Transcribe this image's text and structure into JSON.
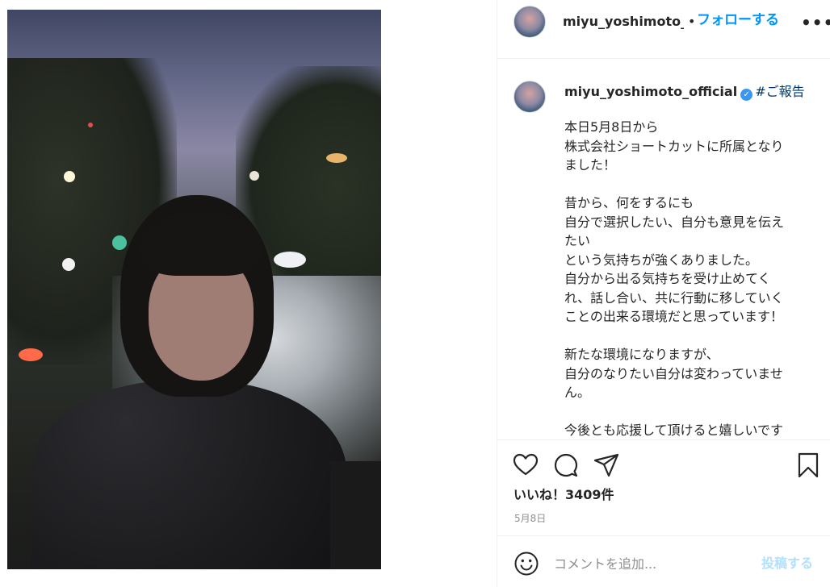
{
  "post": {
    "image_alt": ""
  },
  "header": {
    "username_truncated": "miyu_yoshimoto_o",
    "dot": "•",
    "follow_label": "フォローする",
    "more_label": "•••"
  },
  "caption": {
    "username": "miyu_yoshimoto_official",
    "verified_glyph": "✓",
    "hashtag": "#ご報告",
    "body": "本日5月8日から\n株式会社ショートカットに所属となり\nました！\n\n昔から、何をするにも\n自分で選択したい、自分も意見を伝え\nたい\nという気持ちが強くありました。\n自分から出る気持ちを受け止めてく\nれ、話し合い、共に行動に移していく\nことの出来る環境だと思っています！\n\n新たな環境になりますが、\n自分のなりたい自分は変わっていませ\nん。\n\n今後とも応援して頂けると嬉しいです\n☺"
  },
  "actions": {
    "icons": [
      "heart-icon",
      "comment-icon",
      "share-icon",
      "bookmark-icon"
    ]
  },
  "likes": "いいね！3409件",
  "date": "5月8日",
  "comment": {
    "placeholder": "コメントを追加...",
    "post_label": "投稿する"
  },
  "colors": {
    "accent": "#0095f6",
    "verified": "#3897f0",
    "hashtag": "#00376b",
    "post_disabled": "#b2dffc",
    "muted": "#8e8e8e"
  }
}
